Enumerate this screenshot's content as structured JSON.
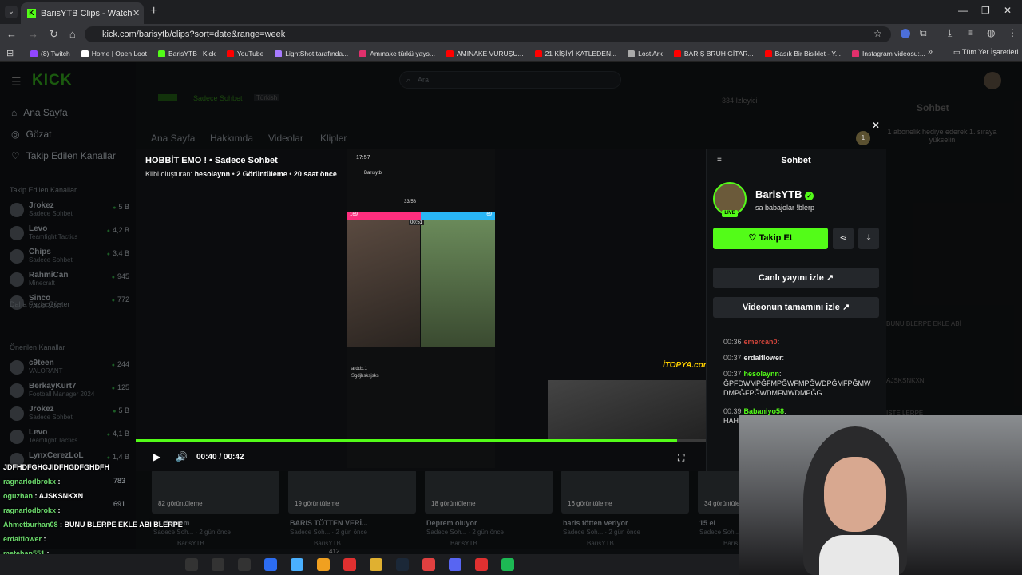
{
  "browser": {
    "tab_title": "BarisYTB Clips - Watch Live on Kick",
    "url": "kick.com/barisytb/clips?sort=date&range=week",
    "bookmarks": [
      "(8) Twitch",
      "Home | Open Loot",
      "BarisYTB | Kick",
      "YouTube",
      "LightShot tarafında...",
      "Amınake türkü yays...",
      "AMINAKE VURUŞU...",
      "21 KİŞİYİ KATLEDEN...",
      "Lost Ark",
      "BARIŞ BRUH GİTAR...",
      "Basık Bir Bisiklet - Y...",
      "Instagram videosu:..."
    ],
    "all_bookmarks": "Tüm Yer İşaretleri",
    "bookmark_colors": [
      "#9146ff",
      "#ffffff",
      "#53fc18",
      "#ff0000",
      "#a77bff",
      "#e1306c",
      "#ff0000",
      "#ff0000",
      "#aaaaaa",
      "#ff0000",
      "#ff0000",
      "#e1306c"
    ]
  },
  "kick": {
    "search_placeholder": "Ara",
    "sidebar_main": [
      {
        "label": "Ana Sayfa",
        "icon": "home-icon"
      },
      {
        "label": "Gözat",
        "icon": "browse-icon"
      },
      {
        "label": "Takip Edilen Kanallar",
        "icon": "heart-icon"
      }
    ],
    "followed_title": "Takip Edilen Kanallar",
    "followed": [
      {
        "name": "Jrokez",
        "game": "Sadece Sohbet",
        "count": "5 B"
      },
      {
        "name": "Levo",
        "game": "Teamfight Tactics",
        "count": "4,2 B"
      },
      {
        "name": "Chips",
        "game": "Sadece Sohbet",
        "count": "3,4 B"
      },
      {
        "name": "RahmiCan",
        "game": "Minecraft",
        "count": "945"
      },
      {
        "name": "Sinco",
        "game": "VALORANT",
        "count": "772"
      }
    ],
    "show_more": "Daha Fazla Göster",
    "recommended_title": "Önerilen Kanallar",
    "recommended": [
      {
        "name": "c9teen",
        "game": "VALORANT",
        "count": "244"
      },
      {
        "name": "BerkayKurt7",
        "game": "Football Manager 2024",
        "count": "125"
      },
      {
        "name": "Jrokez",
        "game": "Sadece Sohbet",
        "count": "5 B"
      },
      {
        "name": "Levo",
        "game": "Teamfight Tactics",
        "count": "4,1 B"
      },
      {
        "name": "LynxCerezLoL",
        "game": "",
        "count": "1,4 B"
      }
    ],
    "channel_tabs": [
      "Ana Sayfa",
      "Hakkımda",
      "Videolar",
      "Klipler"
    ],
    "bg_category": "Sadece Sohbet",
    "bg_lang": "Türkish",
    "bg_viewers": "334 İzleyici",
    "bg_chat_title": "Sohbet",
    "bg_chat_gift": "1 abonelik hediye ederek 1. sıraya yükselin",
    "hidden_counts": [
      "783",
      "691",
      "412"
    ],
    "clips": [
      {
        "views": "82 görüntüleme",
        "title": "us deprem",
        "sub": "Sadece Soh... · 2 gün önce",
        "author": "BarisYTB"
      },
      {
        "views": "19 görüntüleme",
        "title": "BARIS TÖTTEN VERİ...",
        "sub": "Sadece Soh... · 2 gün önce",
        "author": "BarisYTB"
      },
      {
        "views": "18 görüntüleme",
        "title": "Deprem oluyor",
        "sub": "Sadece Soh... · 2 gün önce",
        "author": "BarisYTB"
      },
      {
        "views": "16 görüntüleme",
        "title": "baris tötten veriyor",
        "sub": "Sadece Soh... · 2 gün önce",
        "author": "BarisYTB"
      },
      {
        "views": "34 görüntüleme",
        "title": "15 el",
        "sub": "Sadece Soh...",
        "author": "BarisYTB"
      }
    ]
  },
  "clip": {
    "title": "HOBBİT EMO ! • Sadece Sohbet",
    "creator_label": "Klibi oluşturan:",
    "creator": "hesolaynn",
    "views": "2 Görüntüleme",
    "age": "20 saat önce",
    "time": "00:40 / 00:42",
    "progress": 0.95,
    "phone_time": "17:57",
    "phone_streamer": "Barışytb",
    "battle_score_left": "169",
    "battle_score_right": "69",
    "battle_timer": "00:51",
    "battle_round": "33/58",
    "watermark": "İTOPYA.com"
  },
  "chat_panel": {
    "title": "Sohbet",
    "channel": "BarisYTB",
    "bio": "sa babajolar !blerp",
    "live": "LIVE",
    "follow": "Takip Et",
    "watch_live": "Canlı yayını izle",
    "watch_full": "Videonun tamamını izle",
    "messages": [
      {
        "time": "00:36",
        "user": "emercan0",
        "text": "",
        "color": "#d0443a"
      },
      {
        "time": "00:37",
        "user": "erdalflower",
        "text": "",
        "color": "#e6e6e6"
      },
      {
        "time": "00:37",
        "user": "hesolaynn",
        "text": "ĞPFDWMPĞFMPĞWFMPĞWDPĞMFPĞMW DMPĞFPĞWDMFMWDMPĞG",
        "color": "#53fc18"
      },
      {
        "time": "00:39",
        "user": "Babaniyo58",
        "text": "HAH...",
        "color": "#53fc18"
      }
    ]
  },
  "overlay_chat": [
    {
      "user": "",
      "text": "JDFHDFGHGJIDFHGDFGHDFH"
    },
    {
      "user": "ragnarlodbrokx",
      "text": ""
    },
    {
      "user": "oguzhan",
      "text": "AJSKSNKXN"
    },
    {
      "user": "ragnarlodbrokx",
      "text": ""
    },
    {
      "user": "Ahmetburhan08",
      "text": "BUNU BLERPE EKLE ABİ BLERPE"
    },
    {
      "user": "erdalflower",
      "text": ""
    },
    {
      "user": "metehan551",
      "text": ""
    }
  ],
  "bg_chat_right": [
    "BUNU BLERPE EKLE ABİ",
    "AJSKSNKXN",
    "İŞTE LERPE"
  ],
  "taskbar_icons": [
    "start-icon",
    "search-icon",
    "task-view-icon",
    "steam-icon",
    "copilot-icon",
    "store-icon",
    "chrome-icon",
    "files-icon",
    "steam2-icon",
    "valorant-icon",
    "discord-icon",
    "chrome2-icon",
    "spotify-icon"
  ],
  "colors": {
    "kick_green": "#53fc18",
    "bg": "#0b0d0f"
  }
}
